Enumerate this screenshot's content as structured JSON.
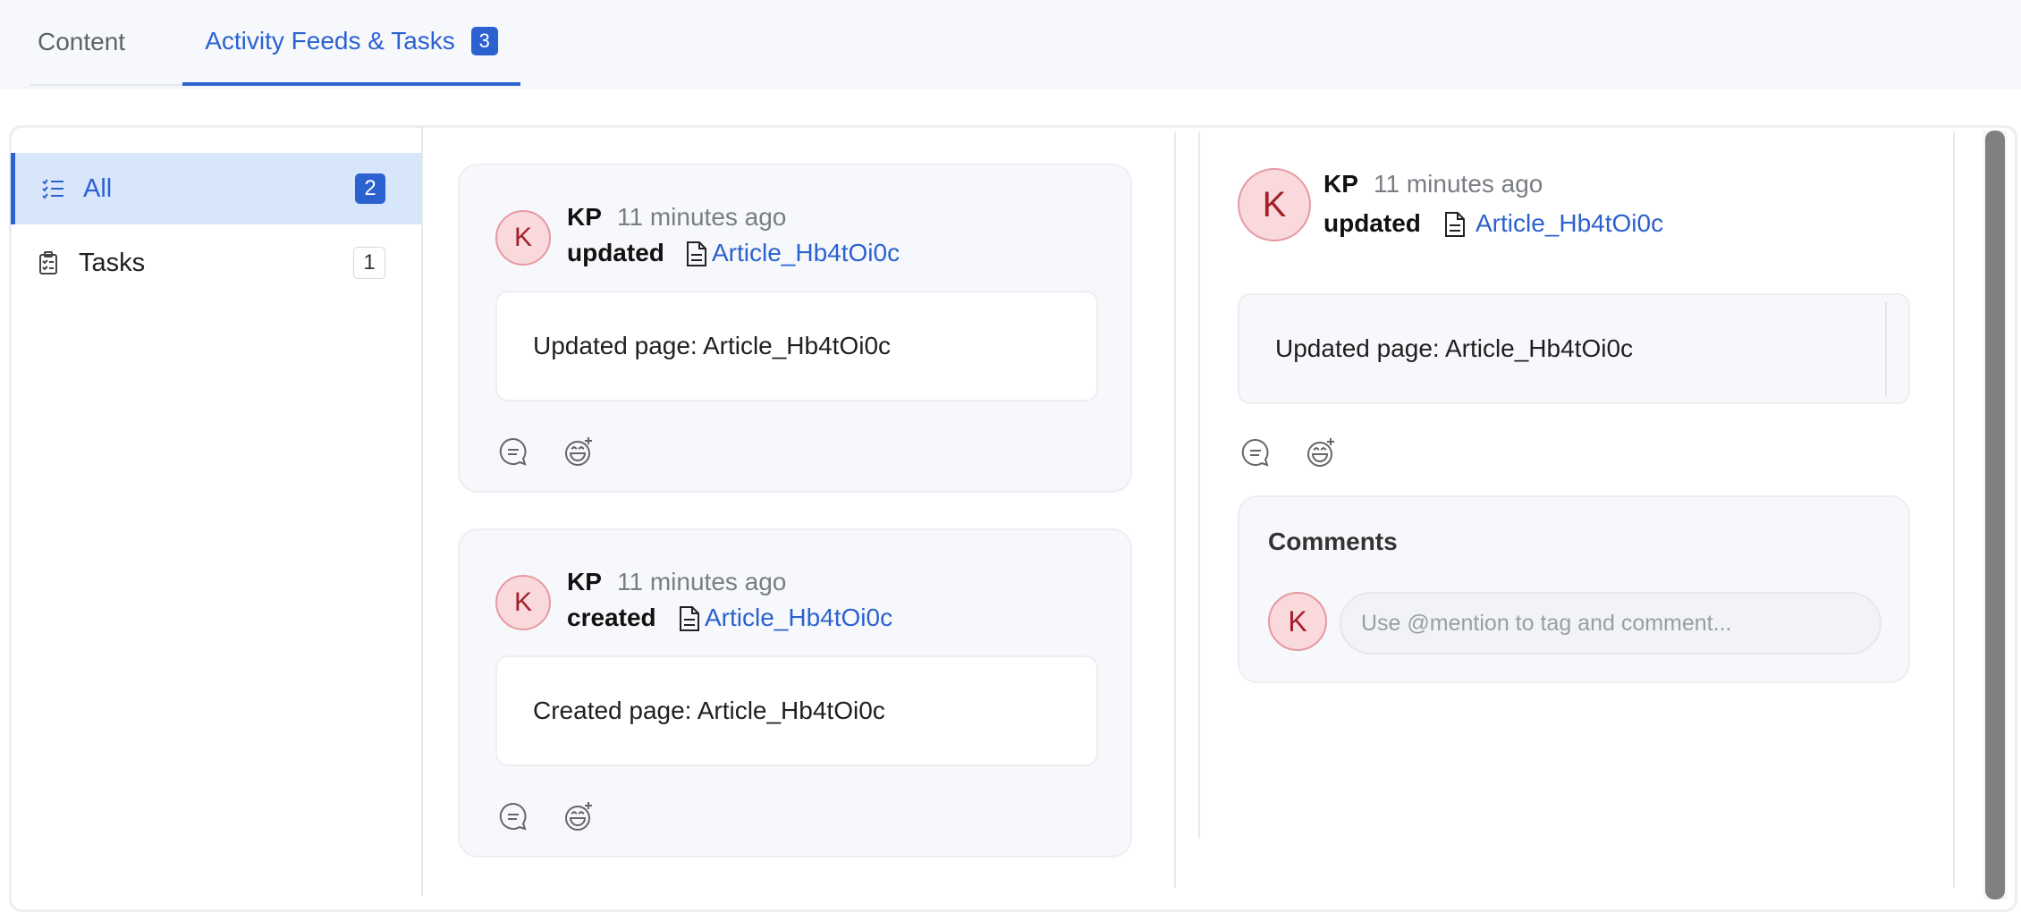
{
  "tabs": [
    {
      "label": "Content"
    },
    {
      "label": "Activity Feeds & Tasks",
      "badge": "3"
    }
  ],
  "sidebar": {
    "items": [
      {
        "label": "All",
        "count": "2",
        "icon": "checklist-icon"
      },
      {
        "label": "Tasks",
        "count": "1",
        "icon": "clipboard-icon"
      }
    ]
  },
  "feed": [
    {
      "avatar": "K",
      "author": "KP",
      "time": "11 minutes ago",
      "action": "updated",
      "link": "Article_Hb4tOi0c",
      "message": "Updated page: Article_Hb4tOi0c"
    },
    {
      "avatar": "K",
      "author": "KP",
      "time": "11 minutes ago",
      "action": "created",
      "link": "Article_Hb4tOi0c",
      "message": "Created page: Article_Hb4tOi0c"
    }
  ],
  "detail": {
    "avatar": "K",
    "author": "KP",
    "time": "11 minutes ago",
    "action": "updated",
    "link": "Article_Hb4tOi0c",
    "message": "Updated page: Article_Hb4tOi0c"
  },
  "comments": {
    "title": "Comments",
    "avatar": "K",
    "placeholder": "Use @mention to tag and comment..."
  },
  "colors": {
    "accent": "#2b62cf",
    "avatar_bg": "#f9d9dc",
    "avatar_text": "#a3202b"
  }
}
